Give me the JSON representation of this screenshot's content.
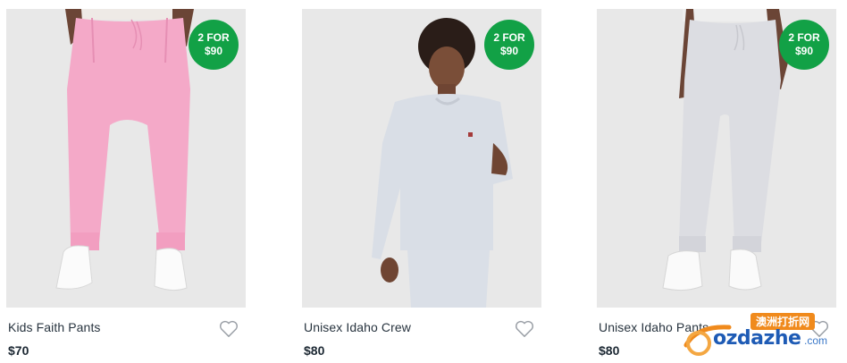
{
  "products": [
    {
      "name": "Kids Faith Pants",
      "price": "$70",
      "badge_line1": "2 FOR",
      "badge_line2": "$90",
      "icon": "heart-outline-icon"
    },
    {
      "name": "Unisex Idaho Crew",
      "price": "$80",
      "badge_line1": "2 FOR",
      "badge_line2": "$90",
      "icon": "heart-outline-icon"
    },
    {
      "name": "Unisex Idaho Pants",
      "price": "$80",
      "badge_line1": "2 FOR",
      "badge_line2": "$90",
      "icon": "heart-outline-icon"
    }
  ],
  "watermark": {
    "tag": "澳洲打折网",
    "text": "ozdazhe",
    "suffix": ".com"
  },
  "colors": {
    "badge": "#12a146",
    "photo_bg": "#e8e8e8",
    "watermark_orange": "#f08a1c",
    "watermark_blue": "#1e5bb5"
  }
}
